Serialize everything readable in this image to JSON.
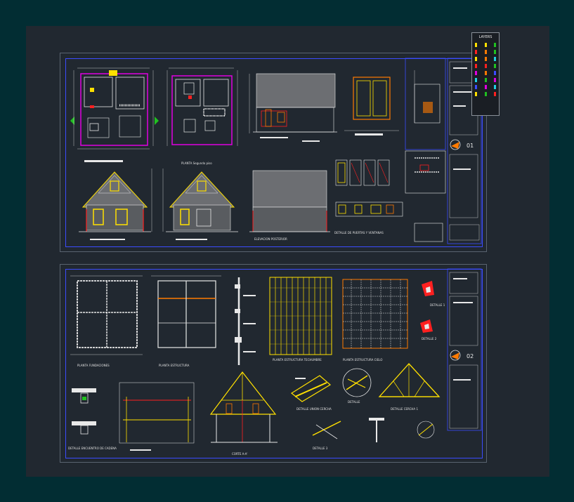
{
  "colors": {
    "background": "#022d33",
    "canvas": "#212830",
    "sheet_border": "#3b4cff",
    "magenta": "#e000e0",
    "yellow": "#ffe000",
    "orange": "#ff7a00",
    "red": "#ff2020",
    "green": "#20c020",
    "white": "#e8e8e8",
    "grey": "#6c6e72",
    "cyan": "#20d0e0"
  },
  "legend": {
    "title": "LAYERS",
    "swatches": [
      [
        "#ffe000",
        "#ffe000",
        "#20c020"
      ],
      [
        "#ff2020",
        "#ff7a00",
        "#20c020"
      ],
      [
        "#ffe000",
        "#ff7a00",
        "#20d0e0"
      ],
      [
        "#ff2020",
        "#ff2020",
        "#20c020"
      ],
      [
        "#e000e0",
        "#ff7a00",
        "#3b4cff"
      ],
      [
        "#20d0e0",
        "#20c020",
        "#e000e0"
      ],
      [
        "#3b4cff",
        "#e000e0",
        "#20d0e0"
      ],
      [
        "#ffe000",
        "#20c020",
        "#ff2020"
      ]
    ]
  },
  "sheet1": {
    "sheet_number": "01",
    "labels": {
      "plan_upper": "PLANTA Segundo piso",
      "doors_windows": "DETALLE DE PUERTAS Y VENTANAS",
      "side_elevation": "ELEVACION POSTERIOR"
    }
  },
  "sheet2": {
    "sheet_number": "02",
    "labels": {
      "foundation": "PLANTA FUNDACIONES",
      "structure": "PLANTA ESTRUCTURA",
      "roof_beams": "PLANTA ESTRUCTURA TECHUMBRE",
      "ceiling_beams": "PLANTA ESTRUCTURA CIELO",
      "detail_1": "DETALLE 1",
      "detail_2": "DETALLE 2",
      "detail_roof": "DETALLE UNION CERCHA",
      "section": "CORTE A-A'",
      "detail_3": "DETALLE 3",
      "detail_truss": "DETALLE CERCHA 1",
      "detail_a": "DETALLE",
      "detail_base": "DETALLE ENCUENTRO DE CADENA"
    }
  }
}
